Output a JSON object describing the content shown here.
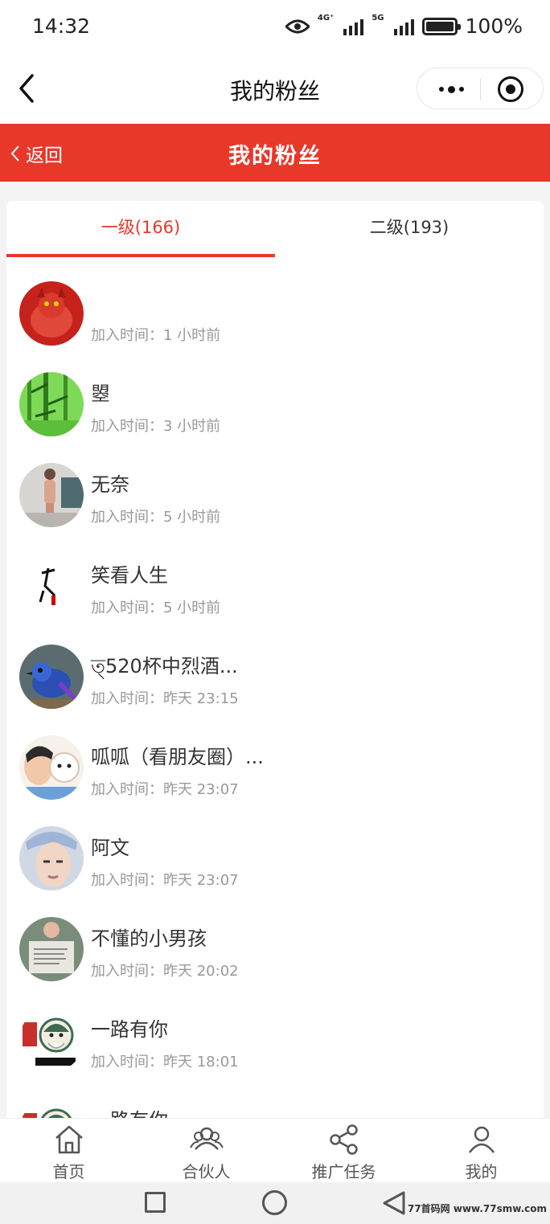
{
  "status": {
    "time": "14:32",
    "net1": "4G⁺",
    "net2": "5G",
    "battery": "100%"
  },
  "wx_nav": {
    "title": "我的粉丝"
  },
  "header": {
    "back_label": "返回",
    "title": "我的粉丝"
  },
  "tabs": [
    {
      "label": "一级(166)",
      "active": true
    },
    {
      "label": "二级(193)",
      "active": false
    }
  ],
  "time_prefix": "加入时间：",
  "fans": [
    {
      "name": "",
      "time": "加入时间：1 小时前",
      "avatar": "red-dragon"
    },
    {
      "name": "曌",
      "time": "加入时间：3 小时前",
      "avatar": "bamboo"
    },
    {
      "name": "无奈",
      "time": "加入时间：5 小时前",
      "avatar": "person-photo"
    },
    {
      "name": "笑看人生",
      "time": "加入时间：5 小时前",
      "avatar": "calligraphy"
    },
    {
      "name": "ত্520杯中烈酒...",
      "time": "加入时间：昨天 23:15",
      "avatar": "blue-bird"
    },
    {
      "name": "呱呱（看朋友圈）...",
      "time": "加入时间：昨天 23:07",
      "avatar": "cartoon-dog"
    },
    {
      "name": "阿文",
      "time": "加入时间：昨天 23:07",
      "avatar": "portrait"
    },
    {
      "name": "不懂的小男孩",
      "time": "加入时间：昨天 20:02",
      "avatar": "photo-text"
    },
    {
      "name": "一路有你",
      "time": "加入时间：昨天 18:01",
      "avatar": "cartoon-elder"
    },
    {
      "name": "一路有你",
      "time": "",
      "avatar": "cartoon-elder"
    }
  ],
  "tabbar": [
    {
      "label": "首页",
      "icon": "home-icon"
    },
    {
      "label": "合伙人",
      "icon": "partners-icon"
    },
    {
      "label": "推广任务",
      "icon": "share-icon"
    },
    {
      "label": "我的",
      "icon": "user-icon"
    }
  ],
  "watermark": "77首码网 www.77smw.com",
  "colors": {
    "accent": "#e8382a",
    "text": "#333333",
    "muted": "#999999"
  }
}
